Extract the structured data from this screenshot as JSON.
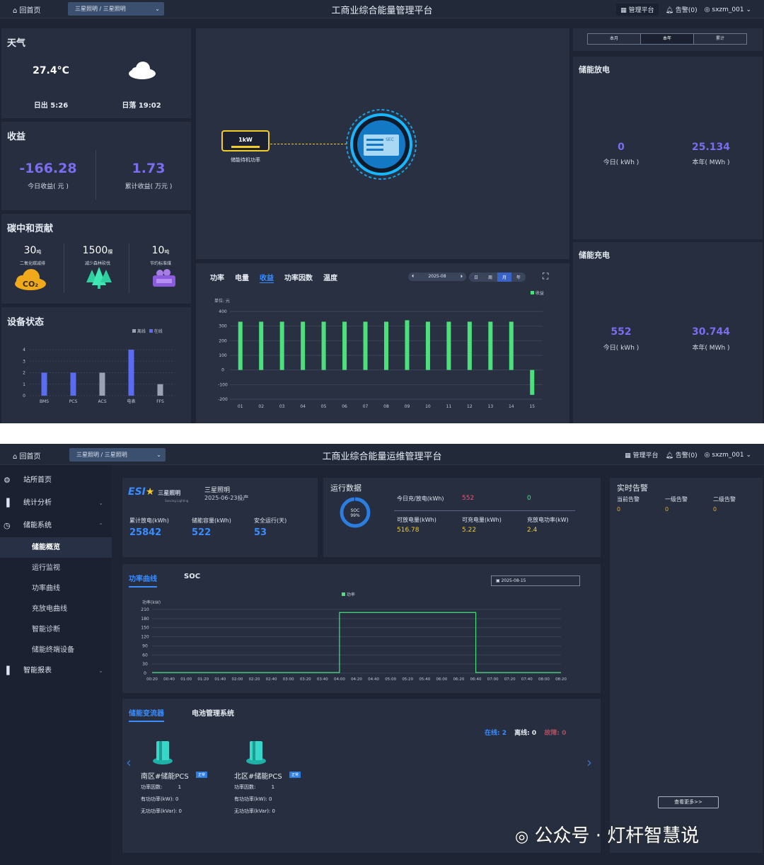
{
  "screen1": {
    "topbar": {
      "home": "回首页",
      "crumb": "三星照明 / 三星照明",
      "title": "工商业综合能量管理平台",
      "manage": "管理平台",
      "alarm": "告警(0)",
      "user": "sxzm_001"
    },
    "weather": {
      "title": "天气",
      "temp": "27.4°C",
      "sunrise": "日出 5:26",
      "sunset": "日落 19:02"
    },
    "income": {
      "title": "收益",
      "today_value": "-166.28",
      "today_label": "今日收益( 元 )",
      "total_value": "1.73",
      "total_label": "累计收益( 万元 )"
    },
    "carbon": {
      "title": "碳中和贡献",
      "items": [
        {
          "value": "30",
          "unit": "吨",
          "label": "二氧化碳减排"
        },
        {
          "value": "1500",
          "unit": "棵",
          "label": "减少森林砍伐"
        },
        {
          "value": "10",
          "unit": "吨",
          "label": "节约标准煤"
        }
      ]
    },
    "device": {
      "title": "设备状态",
      "legend": [
        "离线",
        "在线"
      ],
      "yticks": [
        "0",
        "1",
        "2",
        "3",
        "4"
      ],
      "chart_data": {
        "type": "bar",
        "categories": [
          "BMS",
          "PCS",
          "ACS",
          "电表",
          "FFS"
        ],
        "series": [
          {
            "name": "在线",
            "values": [
              2,
              2,
              0,
              4,
              0
            ]
          },
          {
            "name": "离线",
            "values": [
              0,
              0,
              2,
              0,
              1
            ]
          }
        ],
        "ylim": [
          0,
          4
        ]
      }
    },
    "diagram": {
      "power": "1kW",
      "label": "储能待机功率",
      "device_text": "SEC"
    },
    "tabs": [
      "功率",
      "电量",
      "收益",
      "功率因数",
      "温度"
    ],
    "active_tab": "收益",
    "date": "2025-08",
    "period_buttons": [
      "日",
      "周",
      "月",
      "年"
    ],
    "income_chart": {
      "unit": "单位: 元",
      "legend": "收益",
      "yticks": [
        "400",
        "300",
        "200",
        "100",
        "0",
        "-100",
        "-200"
      ],
      "chart_data": {
        "type": "bar",
        "categories": [
          "01",
          "02",
          "03",
          "04",
          "05",
          "06",
          "07",
          "08",
          "09",
          "10",
          "11",
          "12",
          "13",
          "14",
          "15"
        ],
        "series": [
          {
            "name": "收益",
            "values": [
              330,
              330,
              330,
              330,
              330,
              330,
              330,
              330,
              340,
              330,
              330,
              330,
              330,
              330,
              -170
            ]
          }
        ],
        "ylim": [
          -200,
          400
        ]
      }
    },
    "period_tabs": [
      "本月",
      "本年",
      "累计"
    ],
    "discharge": {
      "title": "储能放电",
      "today_value": "0",
      "today_label": "今日( kWh )",
      "year_value": "25.134",
      "year_label": "本年( MWh )"
    },
    "charge": {
      "title": "储能充电",
      "today_value": "552",
      "today_label": "今日( kWh )",
      "year_value": "30.744",
      "year_label": "本年( MWh )"
    }
  },
  "screen2": {
    "topbar": {
      "home": "回首页",
      "crumb": "三星照明 / 三星照明",
      "title": "工商业综合能量运维管理平台",
      "manage": "管理平台",
      "alarm": "告警(0)",
      "user": "sxzm_001"
    },
    "sidebar": {
      "items": [
        "站所首页",
        "统计分析",
        "储能系统",
        "智能报表"
      ],
      "sub": [
        "储能概览",
        "运行监视",
        "功率曲线",
        "充放电曲线",
        "智能诊断",
        "储能终端设备"
      ]
    },
    "station": {
      "logo_text": "三星照明",
      "logo_sub": "Sancing Lighting",
      "name": "三星照明",
      "date": "2025-06-23投产",
      "stats": [
        {
          "label": "累计放电(kWh)",
          "value": "25842"
        },
        {
          "label": "储能容量(kWh)",
          "value": "522"
        },
        {
          "label": "安全运行(天)",
          "value": "53"
        }
      ]
    },
    "run": {
      "title": "运行数据",
      "soc_label": "SOC",
      "soc_value": "99%",
      "row1_label": "今日充/放电(kWh)",
      "row1_a": "552",
      "row1_b": "0",
      "cells": [
        {
          "label": "可放电量(kWh)",
          "value": "516.78"
        },
        {
          "label": "可充电量(kWh)",
          "value": "5.22"
        },
        {
          "label": "充放电功率(kW)",
          "value": "2.4"
        }
      ]
    },
    "alarm": {
      "title": "实时告警",
      "cols": [
        {
          "label": "当前告警",
          "value": "0"
        },
        {
          "label": "一级告警",
          "value": "0"
        },
        {
          "label": "二级告警",
          "value": "0"
        }
      ],
      "more": "查看更多>>"
    },
    "power": {
      "tabs": [
        "功率曲线",
        "SOC"
      ],
      "date": "2025-08-15",
      "legend": "功率",
      "unit": "功率(kW)",
      "yticks": [
        "0",
        "30",
        "60",
        "90",
        "120",
        "150",
        "180",
        "210"
      ],
      "chart_data": {
        "type": "line",
        "x": [
          "00:20",
          "00:40",
          "01:00",
          "01:20",
          "01:40",
          "02:00",
          "02:20",
          "02:40",
          "03:00",
          "03:20",
          "03:40",
          "04:00",
          "04:20",
          "04:40",
          "05:00",
          "05:20",
          "05:40",
          "06:00",
          "06:20",
          "06:40",
          "07:00",
          "07:20",
          "07:40",
          "08:00",
          "08:20"
        ],
        "series": [
          {
            "name": "功率",
            "values": [
              2,
              2,
              2,
              2,
              2,
              2,
              2,
              2,
              2,
              2,
              2,
              200,
              200,
              200,
              200,
              200,
              200,
              200,
              200,
              2,
              2,
              2,
              2,
              2,
              2
            ]
          }
        ],
        "ylim": [
          0,
          210
        ]
      }
    },
    "devices": {
      "tabs": [
        "储能变流器",
        "电池管理系统"
      ],
      "online_label": "在线:",
      "online": "2",
      "offline_label": "离线:",
      "offline": "0",
      "fault_label": "故障:",
      "fault": "0",
      "items": [
        {
          "name": "南区#储能PCS",
          "badge": "正常",
          "pf_label": "功率因数:",
          "pf": "1",
          "p_label": "有功功率(kW):",
          "p": "0",
          "q_label": "无功功率(kVar):",
          "q": "0"
        },
        {
          "name": "北区#储能PCS",
          "badge": "正常",
          "pf_label": "功率因数:",
          "pf": "1",
          "p_label": "有功功率(kW):",
          "p": "0",
          "q_label": "无功功率(kVar):",
          "q": "0"
        }
      ]
    },
    "watermark": "公众号 · 灯杆智慧说"
  }
}
